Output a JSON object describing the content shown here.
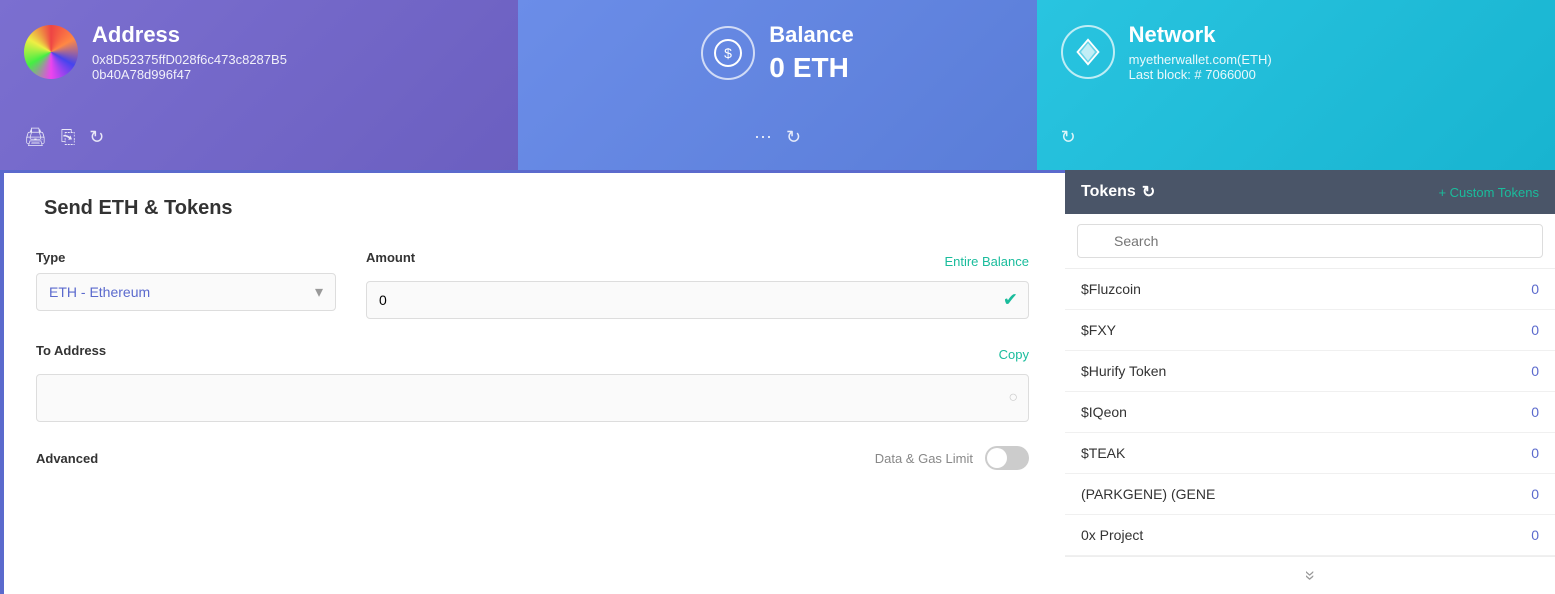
{
  "address_card": {
    "title": "Address",
    "address_line1": "0x8D52375ffD028f6c473c8287B5",
    "address_line2": "0b40A78d996f47"
  },
  "balance_card": {
    "title": "Balance",
    "amount": "0",
    "unit": "ETH"
  },
  "network_card": {
    "title": "Network",
    "network_name": "myetherwallet.com(ETH)",
    "last_block": "Last block: # 7066000"
  },
  "send_section": {
    "title": "Send ETH & Tokens",
    "type_label": "Type",
    "type_option": "ETH - Ethereum",
    "amount_label": "Amount",
    "amount_value": "0",
    "entire_balance": "Entire Balance",
    "to_address_label": "To Address",
    "copy_label": "Copy",
    "advanced_label": "Advanced",
    "data_gas_label": "Data & Gas Limit"
  },
  "tokens": {
    "title": "Tokens",
    "custom_tokens": "+ Custom Tokens",
    "search_placeholder": "Search",
    "items": [
      {
        "name": "$Fluzcoin",
        "balance": "0"
      },
      {
        "name": "$FXY",
        "balance": "0"
      },
      {
        "name": "$Hurify Token",
        "balance": "0"
      },
      {
        "name": "$IQeon",
        "balance": "0"
      },
      {
        "name": "$TEAK",
        "balance": "0"
      },
      {
        "name": "(PARKGENE) (GENE",
        "balance": "0"
      },
      {
        "name": "0x Project",
        "balance": "0"
      }
    ]
  },
  "icons": {
    "print": "🖨",
    "copy": "⎘",
    "refresh": "↻",
    "ellipsis": "⋯",
    "search": "🔍",
    "chevron_down": "▾",
    "check": "✔",
    "circle": "○",
    "double_chevron": "⋙"
  }
}
